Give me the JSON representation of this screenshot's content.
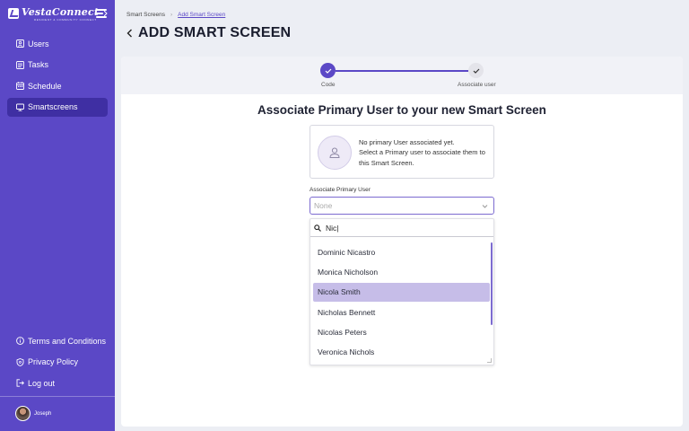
{
  "brand": {
    "name": "VestaConnect",
    "tagline": "RESIDENT & COMMUNITY CONNECT"
  },
  "sidebar": {
    "items": [
      {
        "label": "Users",
        "icon": "users-icon"
      },
      {
        "label": "Tasks",
        "icon": "tasks-icon"
      },
      {
        "label": "Schedule",
        "icon": "calendar-icon"
      },
      {
        "label": "Smartscreens",
        "icon": "monitor-icon",
        "active": true
      }
    ],
    "bottom_items": [
      {
        "label": "Terms and Conditions",
        "icon": "info-icon"
      },
      {
        "label": "Privacy Policy",
        "icon": "shield-icon"
      },
      {
        "label": "Log out",
        "icon": "logout-icon"
      }
    ],
    "user": {
      "name": "Joseph"
    }
  },
  "breadcrumb": {
    "parent": "Smart Screens",
    "separator": "›",
    "current": "Add Smart Screen"
  },
  "page": {
    "title": "ADD SMART SCREEN"
  },
  "stepper": {
    "steps": [
      {
        "label": "Code",
        "state": "complete"
      },
      {
        "label": "Associate user",
        "state": "active"
      }
    ]
  },
  "main": {
    "heading": "Associate Primary User to your new Smart Screen",
    "notice": {
      "line1": "No primary User associated yet.",
      "line2": "Select a Primary user to associate them to this Smart Screen."
    },
    "field_label": "Associate Primary User",
    "select_value": "None",
    "search_value": "Nic|",
    "options": [
      "Dominic Nicastro",
      "Monica Nicholson",
      "Nicola Smith",
      "Nicholas Bennett",
      "Nicolas Peters",
      "Veronica Nichols"
    ],
    "highlighted_option": "Nicola Smith"
  },
  "colors": {
    "sidebar_bg": "#5b48c6",
    "sidebar_active": "#3f2fa3",
    "accent": "#5b48c6",
    "highlight": "#c6bde8"
  }
}
